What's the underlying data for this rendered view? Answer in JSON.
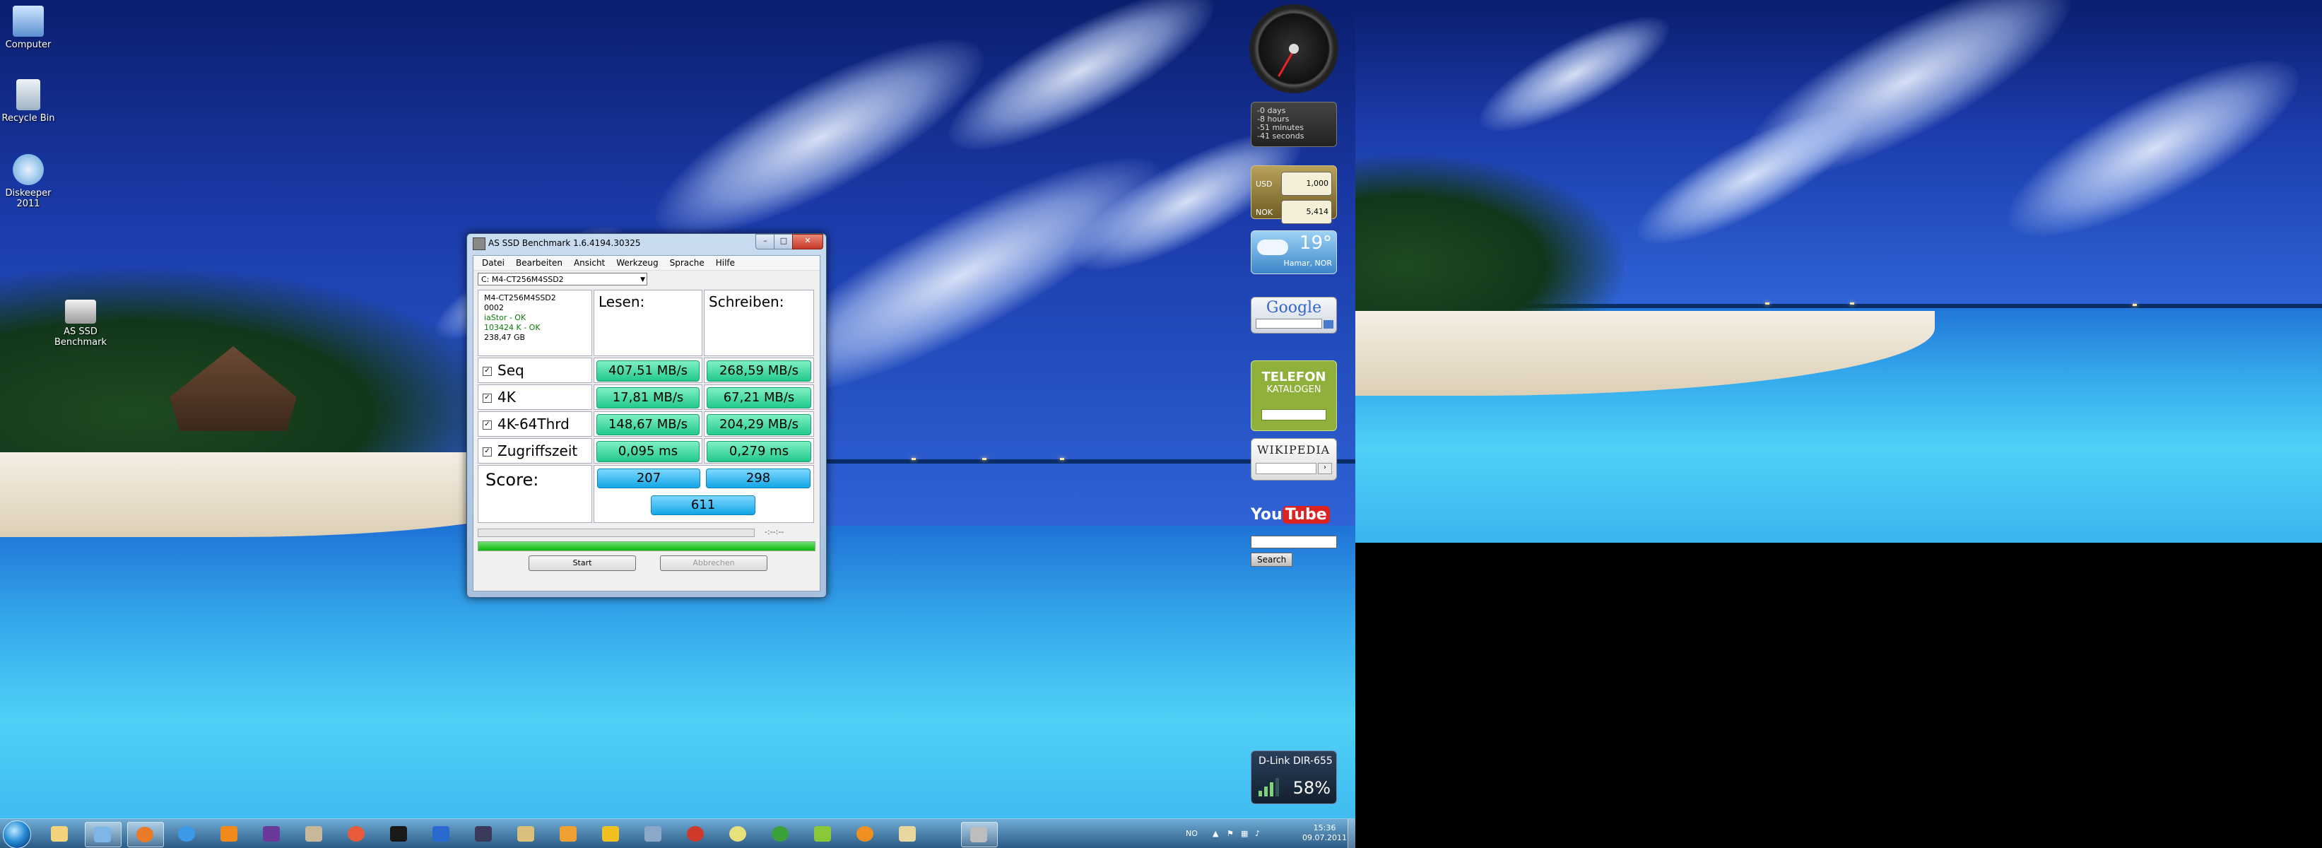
{
  "desktop": {
    "icons": [
      {
        "label": "Computer"
      },
      {
        "label": "Recycle Bin"
      },
      {
        "label": "Diskeeper 2011"
      },
      {
        "label": "AS SSD Benchmark"
      }
    ]
  },
  "gadgets": {
    "countdown": {
      "lines": [
        "-0 days",
        "-8 hours",
        "-51 minutes",
        "-41 seconds"
      ]
    },
    "currency": {
      "rows": [
        {
          "code": "USD",
          "value": "1,000"
        },
        {
          "code": "NOK",
          "value": "5,414"
        }
      ]
    },
    "weather": {
      "temp": "19°",
      "city": "Hamar, NOR"
    },
    "google": {
      "logo": "Google"
    },
    "telefon": {
      "line1": "TELEFON",
      "line2": "KATALOGEN"
    },
    "wikipedia": {
      "logo": "WIKIPEDIA"
    },
    "youtube": {
      "you": "You",
      "tube": "Tube",
      "search_label": "Search"
    },
    "network": {
      "name": "D-Link DIR-655",
      "signal": "58%",
      "signal_level": 0.58
    }
  },
  "app": {
    "title": "AS SSD Benchmark 1.6.4194.30325",
    "menu": [
      "Datei",
      "Bearbeiten",
      "Ansicht",
      "Werkzeug",
      "Sprache",
      "Hilfe"
    ],
    "drive_select": "C: M4-CT256M4SSD2",
    "info": {
      "model": "M4-CT256M4SSD2",
      "firmware": "0002",
      "driver": "iaStor - OK",
      "alignment": "103424 K - OK",
      "size": "238,47 GB"
    },
    "headers": {
      "read": "Lesen:",
      "write": "Schreiben:"
    },
    "rows": [
      {
        "label": "Seq",
        "read": "407,51 MB/s",
        "write": "268,59 MB/s"
      },
      {
        "label": "4K",
        "read": "17,81 MB/s",
        "write": "67,21 MB/s"
      },
      {
        "label": "4K-64Thrd",
        "read": "148,67 MB/s",
        "write": "204,29 MB/s"
      },
      {
        "label": "Zugriffszeit",
        "read": "0,095 ms",
        "write": "0,279 ms"
      }
    ],
    "score": {
      "label": "Score:",
      "read": "207",
      "write": "298",
      "total": "611"
    },
    "timer": "-:--:--",
    "progress": 1.0,
    "buttons": {
      "start": "Start",
      "abort": "Abbrechen"
    }
  },
  "taskbar": {
    "lang": "NO",
    "time": "15:36",
    "date": "09.07.2011"
  }
}
